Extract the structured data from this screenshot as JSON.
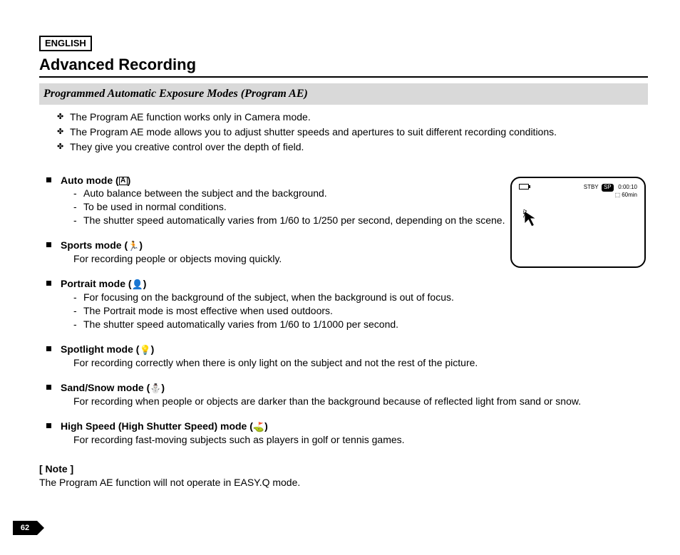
{
  "lang": "ENGLISH",
  "title": "Advanced Recording",
  "section": "Programmed Automatic Exposure Modes (Program AE)",
  "intro": [
    "The Program AE function works only in Camera mode.",
    "The Program AE mode allows you to adjust shutter speeds and apertures to suit different recording conditions.",
    "They give you creative control over the depth of field."
  ],
  "modes": {
    "auto": {
      "title": "Auto mode (",
      "title_close": ")",
      "icon": "A",
      "items": [
        "Auto balance between the subject and the background.",
        "To be used in normal conditions.",
        "The shutter speed automatically varies from 1/60 to 1/250 per second, depending on the scene."
      ]
    },
    "sports": {
      "title": "Sports mode (",
      "title_close": ")",
      "icon": "🏃",
      "desc": "For recording people or objects moving quickly."
    },
    "portrait": {
      "title": "Portrait mode (",
      "title_close": ")",
      "icon": "👤",
      "items": [
        "For focusing on the background of the subject, when the background is out of focus.",
        "The Portrait mode is most effective when used outdoors.",
        "The shutter speed automatically varies from 1/60 to 1/1000 per second."
      ]
    },
    "spotlight": {
      "title": "Spotlight mode (",
      "title_close": ")",
      "icon": "💡",
      "desc": "For recording correctly when there is only light on the subject and not the rest of the picture."
    },
    "sand_snow": {
      "title": "Sand/Snow mode (",
      "title_close": ")",
      "icon": "⛄",
      "desc": "For recording when people or objects are darker than the background because of reflected light from sand or snow."
    },
    "high_speed": {
      "title": "High Speed (High Shutter Speed) mode (",
      "title_close": ")",
      "icon": "⛳",
      "desc": "For recording fast-moving subjects such as players in golf or tennis games."
    }
  },
  "note": {
    "label": "[ Note ]",
    "text": "The Program AE function will not operate in EASY.Q mode."
  },
  "page_number": "62",
  "screen": {
    "stby": "STBY",
    "sp": "SP",
    "time": "0:00:10",
    "remain": "60min"
  }
}
